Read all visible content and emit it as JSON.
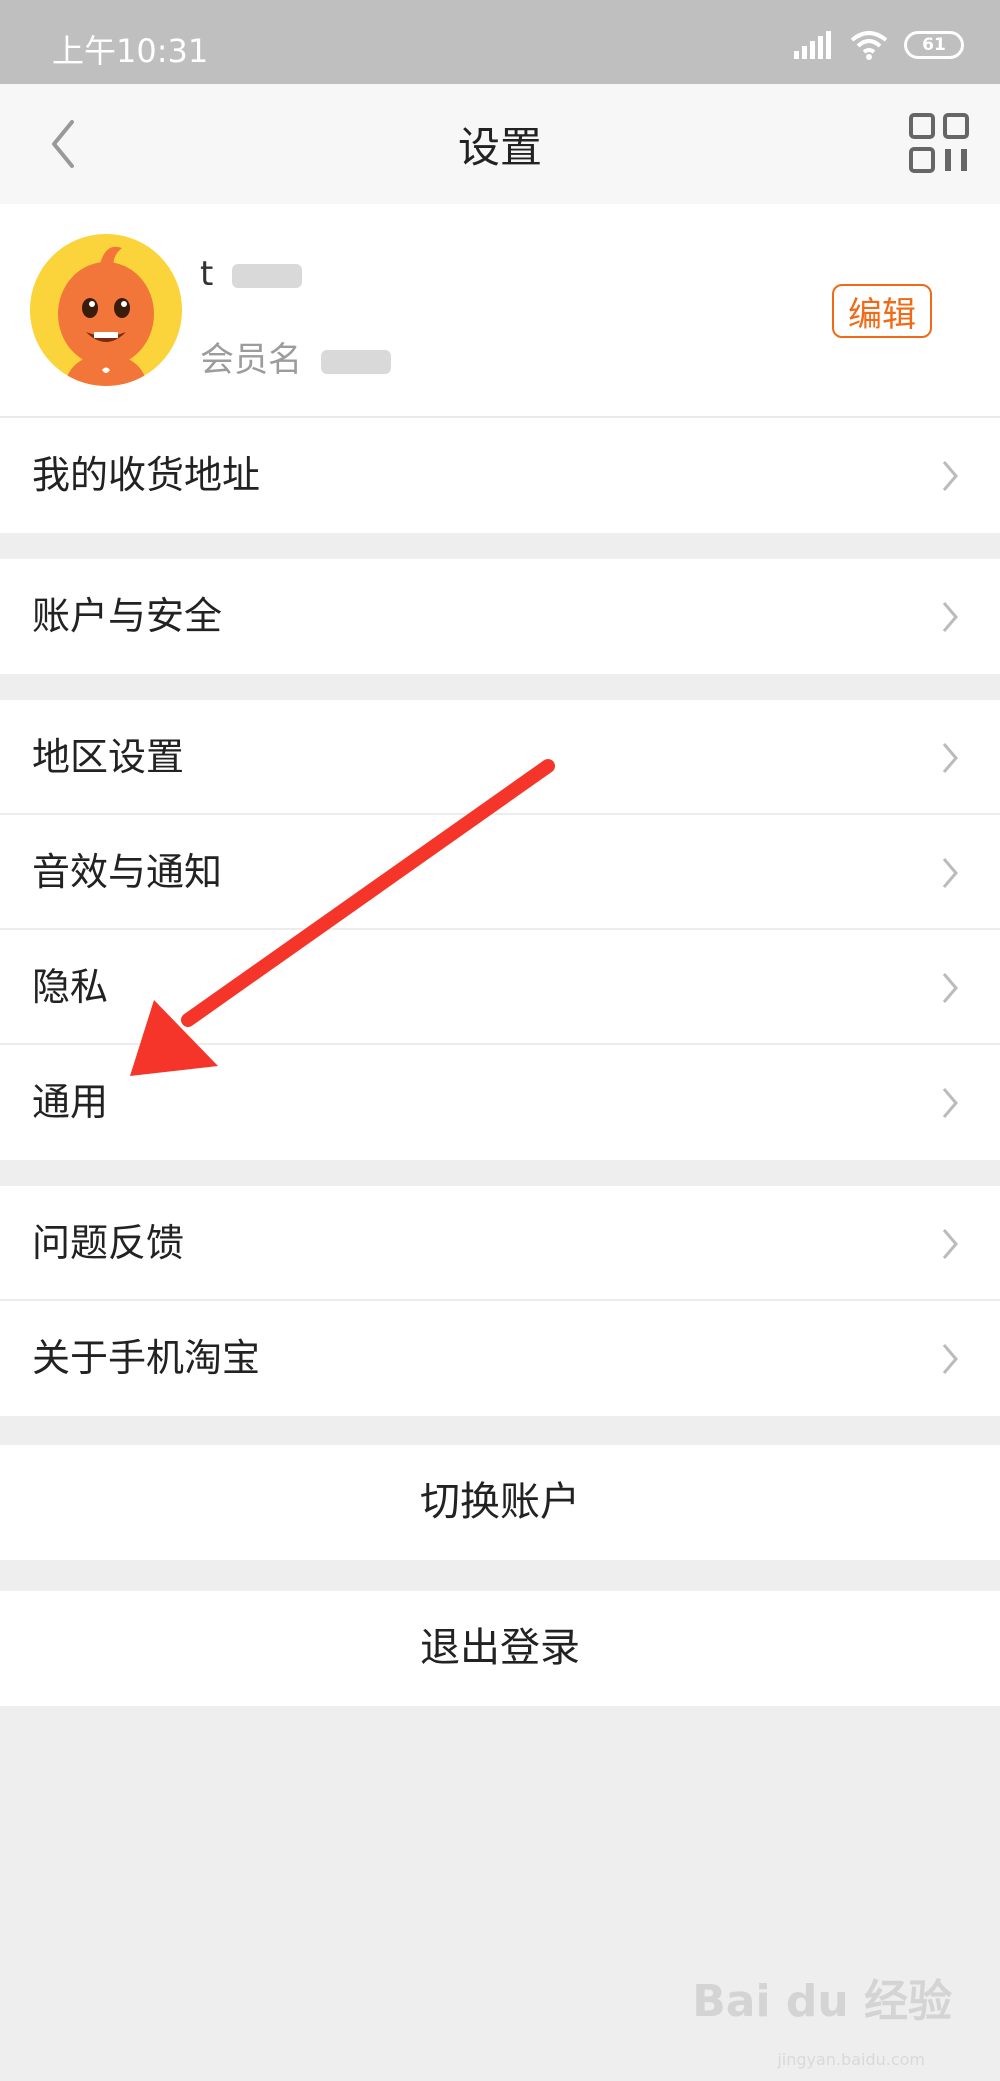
{
  "status_bar": {
    "time": "上午10:31",
    "battery": "61"
  },
  "nav": {
    "title": "设置",
    "back_icon": "chevron-left-icon",
    "qr_icon": "qr-code-icon"
  },
  "profile": {
    "name_initial": "t",
    "member_label": "会员名",
    "edit_label": "编辑"
  },
  "groups": [
    {
      "items": [
        {
          "label": "我的收货地址"
        }
      ]
    },
    {
      "items": [
        {
          "label": "账户与安全"
        }
      ]
    },
    {
      "items": [
        {
          "label": "地区设置"
        },
        {
          "label": "音效与通知"
        },
        {
          "label": "隐私"
        },
        {
          "label": "通用"
        }
      ]
    },
    {
      "items": [
        {
          "label": "问题反馈"
        },
        {
          "label": "关于手机淘宝"
        }
      ]
    }
  ],
  "actions": {
    "switch_account": "切换账户",
    "logout": "退出登录"
  },
  "colors": {
    "accent": "#f06a17",
    "annotation_arrow": "#f5352a",
    "background": "#eeeeee"
  },
  "watermark": {
    "brand": "Bai du 经验",
    "sub": "jingyan.baidu.com"
  }
}
